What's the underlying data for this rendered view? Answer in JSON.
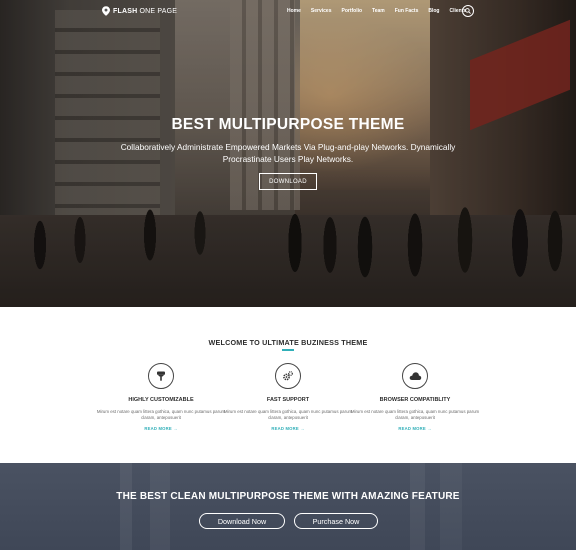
{
  "brand": {
    "name_bold": "FLASH",
    "name_light": " ONE PAGE"
  },
  "nav": {
    "items": [
      "Home",
      "Services",
      "Portfolio",
      "Team",
      "Fun Facts",
      "Blog",
      "Clients"
    ],
    "search_icon": "search-icon"
  },
  "hero": {
    "title": "BEST MULTIPURPOSE THEME",
    "subtitle": "Collaboratively Administrate Empowered Markets Via Plug-and-play Networks. Dynamically Procrastinate Users Play Networks.",
    "button_label": "DOWNLOAD"
  },
  "features": {
    "heading": "WELCOME TO ULTIMATE BUZINESS THEME",
    "accent_color": "#30afb8",
    "items": [
      {
        "icon": "magic-wand-icon",
        "title": "HIGHLY CUSTOMIZABLE",
        "text": "Mirum est notare quam littera gothica, quam nunc putamus parum claram, anteposuerit",
        "link": "READ MORE →"
      },
      {
        "icon": "gears-icon",
        "title": "FAST SUPPORT",
        "text": "Mirum est notare quam littera gothica, quam nunc putamus parum claram, anteposuerit",
        "link": "READ MORE →"
      },
      {
        "icon": "cloud-icon",
        "title": "BROWSER COMPATIBLITY",
        "text": "Mirum est notare quam littera gothica, quam nunc putamus parum claram, anteposuerit",
        "link": "READ MORE →"
      }
    ]
  },
  "cta": {
    "title": "THE BEST CLEAN MULTIPURPOSE THEME WITH AMAZING FEATURE",
    "primary_label": "Download Now",
    "secondary_label": "Purchase Now"
  }
}
